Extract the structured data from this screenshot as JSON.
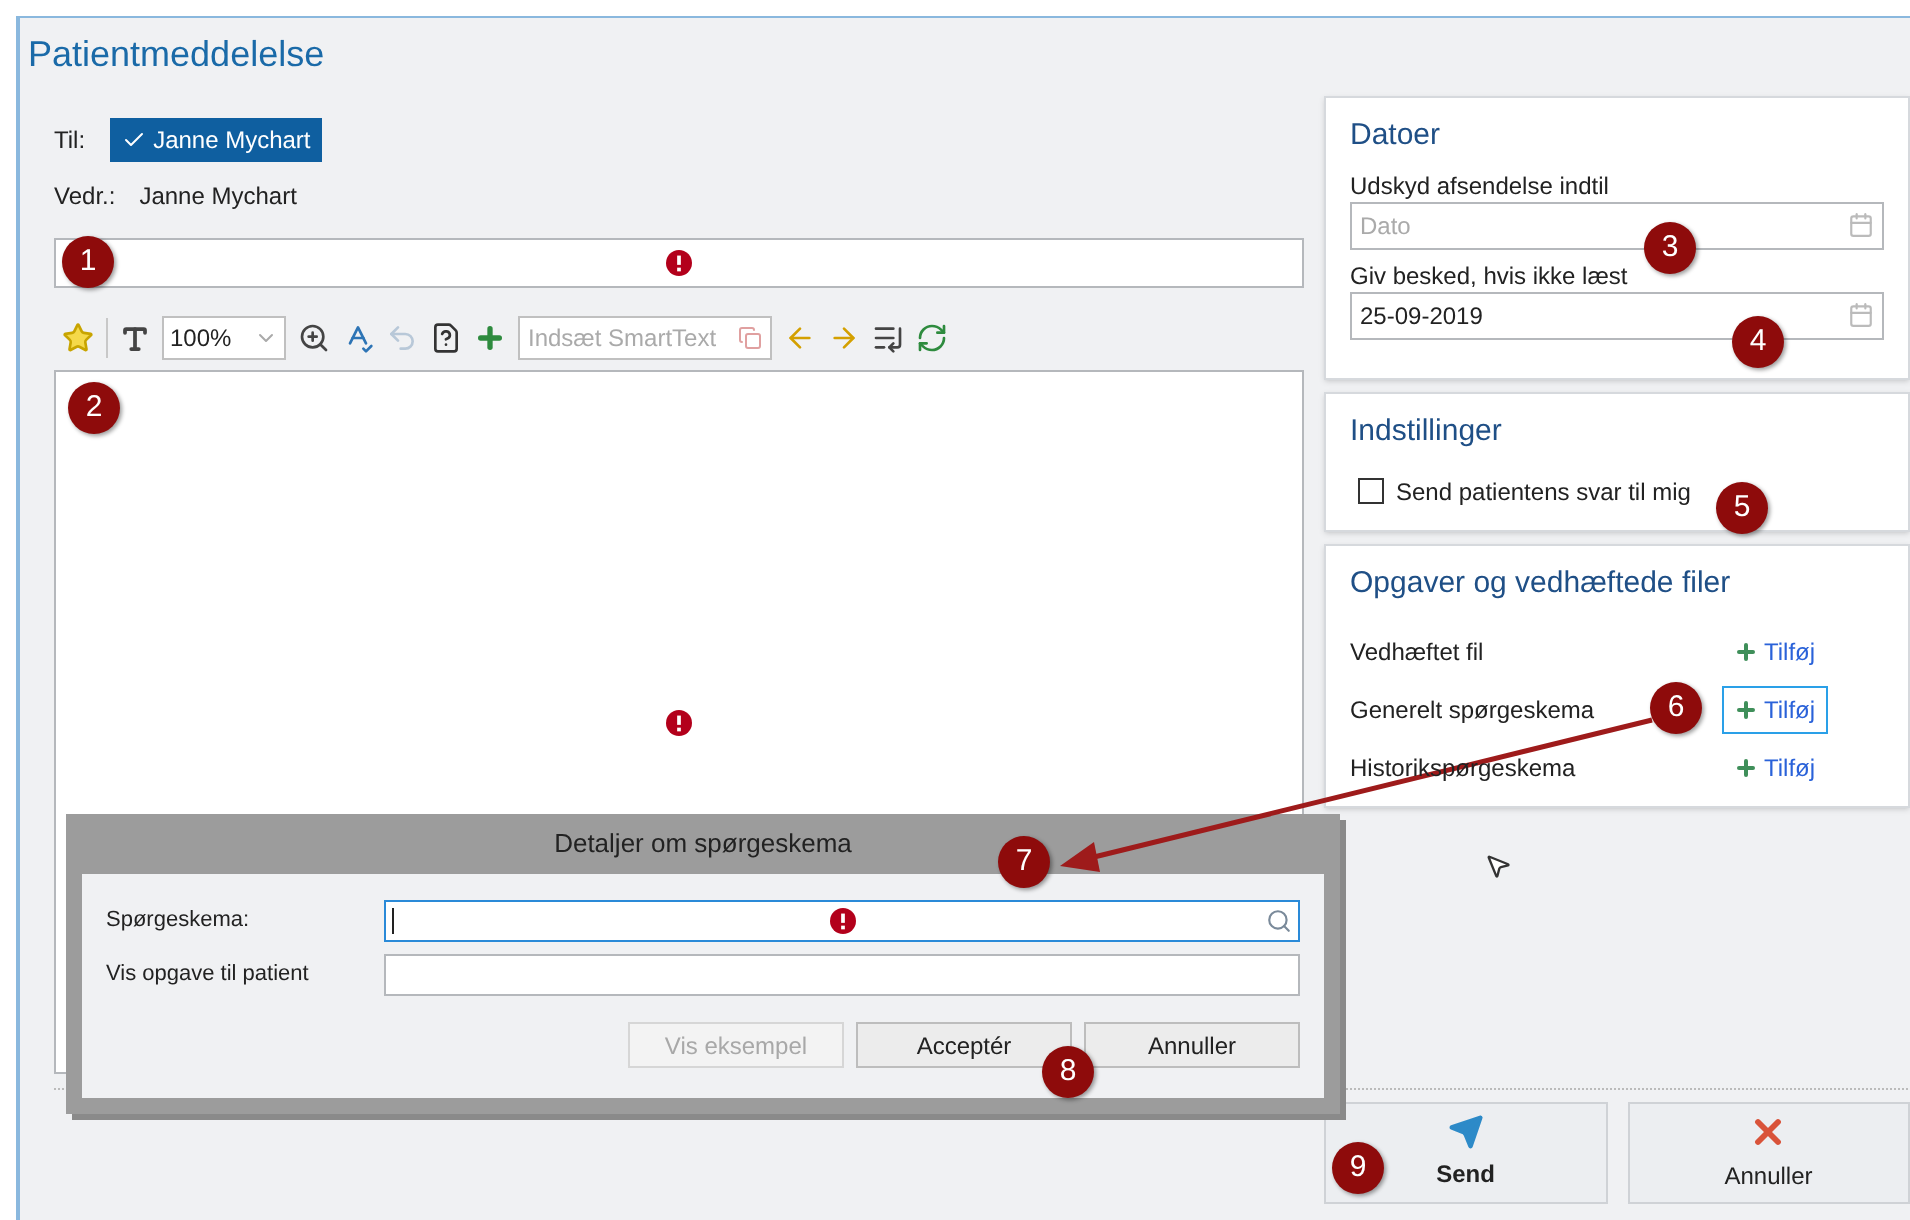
{
  "title": "Patientmeddelelse",
  "to": {
    "label": "Til:",
    "recipient": {
      "name": "Janne Mychart",
      "selected": true
    }
  },
  "regarding": {
    "label": "Vedr.:",
    "value": "Janne Mychart"
  },
  "subject_field": {
    "error": true
  },
  "toolbar": {
    "zoom": "100%",
    "smarttext_placeholder": "Indsæt SmartText"
  },
  "body_field": {
    "error": true
  },
  "dates": {
    "title": "Datoer",
    "fields": [
      {
        "label": "Udskyd afsendelse indtil",
        "placeholder": "Dato"
      },
      {
        "label": "Giv besked, hvis ikke læst",
        "value": "25-09-2019"
      }
    ]
  },
  "settings": {
    "title": "Indstillinger",
    "options": [
      {
        "label": "Send patientens svar til mig",
        "checked": false
      }
    ]
  },
  "attachments": {
    "title": "Opgaver og vedhæftede filer",
    "rows": [
      {
        "label": "Vedhæftet fil",
        "action": "Tilføj",
        "focused": false
      },
      {
        "label": "Generelt spørgeskema",
        "action": "Tilføj",
        "focused": true
      },
      {
        "label": "Historikspørgeskema",
        "action": "Tilføj",
        "focused": false
      }
    ]
  },
  "dialog": {
    "title": "Detaljer om spørgeskema",
    "fields": [
      {
        "label": "Spørgeskema:",
        "kind": "search",
        "focused": true,
        "error": true
      },
      {
        "label": "Vis opgave til patient",
        "kind": "text",
        "focused": false,
        "error": false
      }
    ],
    "buttons": [
      {
        "label": "Vis eksempel",
        "disabled": true
      },
      {
        "label": "Acceptér",
        "disabled": false
      },
      {
        "label": "Annuller",
        "disabled": false
      }
    ]
  },
  "footer_buttons": [
    {
      "label": "Send",
      "kind": "send"
    },
    {
      "label": "Annuller",
      "kind": "cancel"
    }
  ],
  "callouts": [
    "1",
    "2",
    "3",
    "4",
    "5",
    "6",
    "7",
    "8",
    "9"
  ]
}
